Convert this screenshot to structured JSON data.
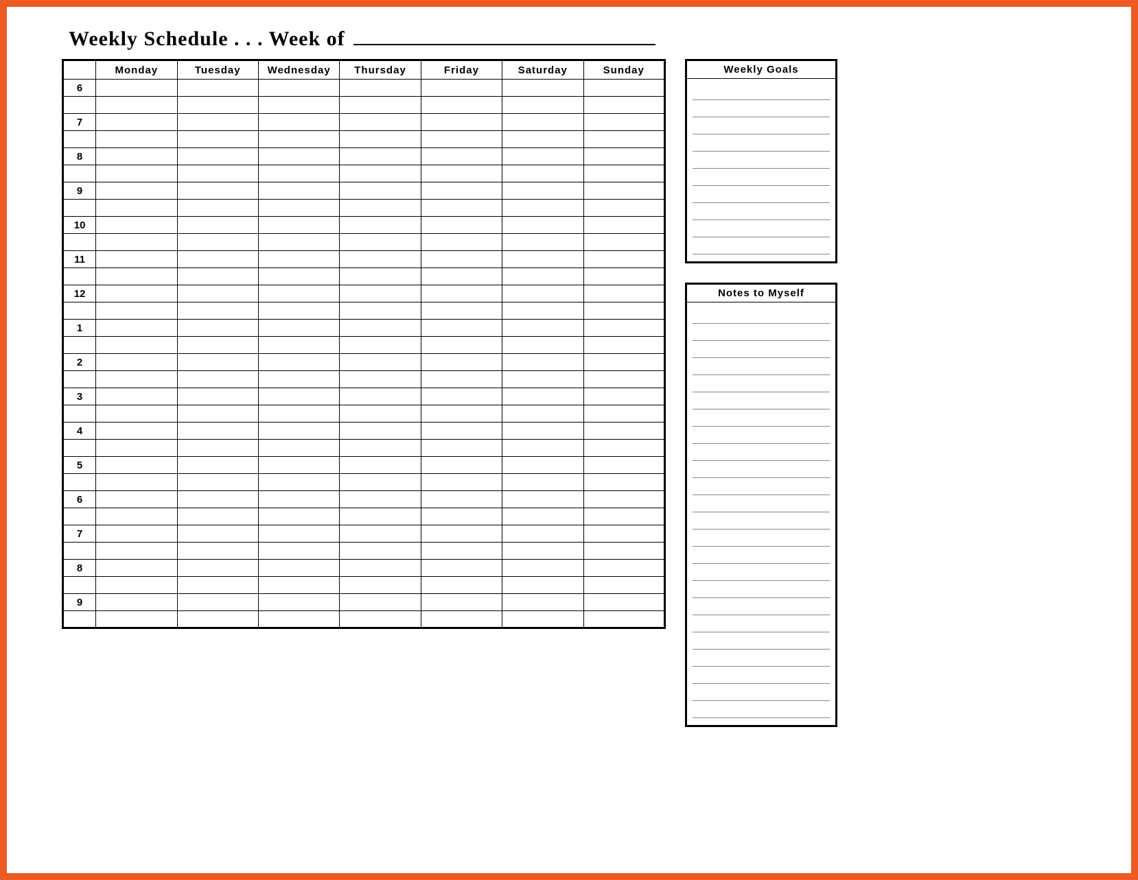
{
  "title": {
    "prefix": "Weekly Schedule . . . Week of ",
    "value": ""
  },
  "schedule": {
    "days": [
      "Monday",
      "Tuesday",
      "Wednesday",
      "Thursday",
      "Friday",
      "Saturday",
      "Sunday"
    ],
    "hours": [
      "6",
      "7",
      "8",
      "9",
      "10",
      "11",
      "12",
      "1",
      "2",
      "3",
      "4",
      "5",
      "6",
      "7",
      "8",
      "9"
    ],
    "slotsPerHour": 2
  },
  "sidebar": {
    "goals": {
      "heading": "Weekly Goals",
      "lineCount": 10
    },
    "notes": {
      "heading": "Notes to Myself",
      "lineCount": 24
    }
  }
}
